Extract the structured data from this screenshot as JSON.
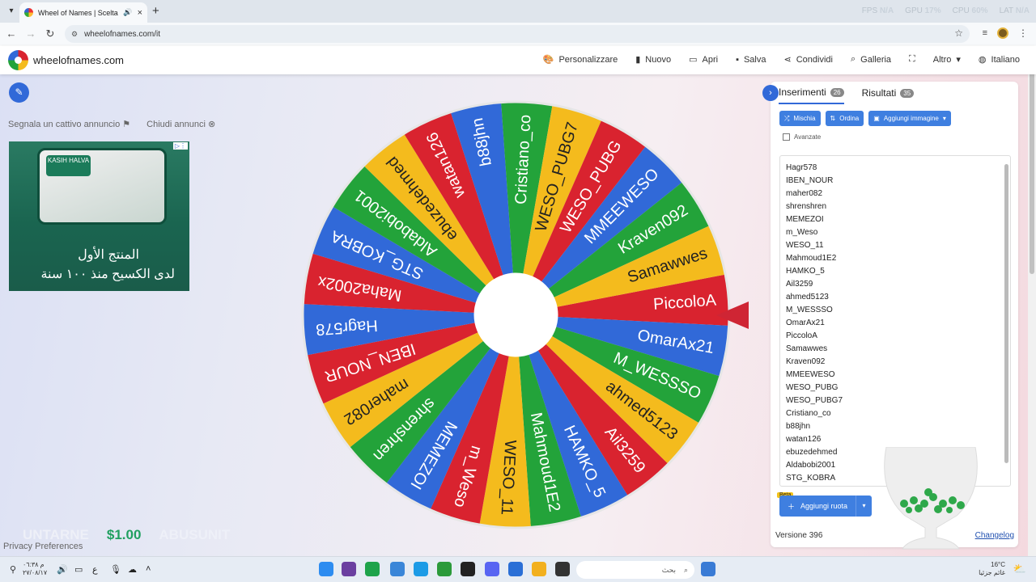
{
  "browser": {
    "tab_title": "Wheel of Names | Scelta ca",
    "url": "wheelofnames.com/it",
    "sys": [
      {
        "label": "FPS",
        "value": "N/A"
      },
      {
        "label": "GPU",
        "value": "17%"
      },
      {
        "label": "CPU",
        "value": "60%"
      },
      {
        "label": "LAT",
        "value": "N/A"
      }
    ]
  },
  "header": {
    "brand": "wheelofnames.com",
    "menu": [
      "Personalizzare",
      "Nuovo",
      "Apri",
      "Salva",
      "Condividi",
      "Galleria",
      "",
      "Altro",
      "Italiano"
    ]
  },
  "left": {
    "report_ad": "Segnala un cattivo annuncio",
    "close_ads": "Chiudi annunci",
    "ad_line1": "المنتج الأول",
    "ad_line2": "لدى الكسيح منذ ١٠٠ سنة",
    "ad_brand": "KASIH HALVA",
    "promo_left": "UNTARNE",
    "promo_price": "$1.00",
    "promo_right": "ABUSUNIT",
    "privacy": "Privacy Preferences"
  },
  "panel": {
    "tab_entries": "Inserimenti",
    "tab_entries_count": "26",
    "tab_results": "Risultati",
    "tab_results_count": "35",
    "btn_shuffle": "Mischia",
    "btn_sort": "Ordina",
    "btn_add_image": "Aggiungi immagine",
    "advanced": "Avanzate",
    "add_wheel": "Aggiungi ruota",
    "beta": "Beta",
    "version": "Versione 396",
    "changelog": "Changelog"
  },
  "entries": [
    "Hagr578",
    "IBEN_NOUR",
    "maher082",
    "shrenshren",
    "MEMEZOI",
    "m_Weso",
    "WESO_11",
    "Mahmoud1E2",
    "HAMKO_5",
    "Ail3259",
    "ahmed5123",
    "M_WESSSO",
    "OmarAx21",
    "PiccoloA",
    "Samawwes",
    "Kraven092",
    "MMEEWESO",
    "WESO_PUBG",
    "WESO_PUBG7",
    "Cristiano_co",
    "b88jhn",
    "watan126",
    "ebuzedehmed",
    "Aldabobi2001",
    "STG_KOBRA"
  ],
  "wheel": {
    "pointer_color": "#cf2534",
    "segments": [
      {
        "label": "PiccoloA",
        "color": "#d9232f"
      },
      {
        "label": "OmarAx21",
        "color": "#3169d8"
      },
      {
        "label": "M_WESSSO",
        "color": "#23a33a"
      },
      {
        "label": "ahmed5123",
        "color": "#f4bb1d"
      },
      {
        "label": "Ail3259",
        "color": "#d9232f"
      },
      {
        "label": "HAMKO_5",
        "color": "#3169d8"
      },
      {
        "label": "Mahmoud1E2",
        "color": "#23a33a"
      },
      {
        "label": "WESO_11",
        "color": "#f4bb1d"
      },
      {
        "label": "m_Weso",
        "color": "#d9232f"
      },
      {
        "label": "MEMEZOI",
        "color": "#3169d8"
      },
      {
        "label": "shrenshren",
        "color": "#23a33a"
      },
      {
        "label": "maher082",
        "color": "#f4bb1d"
      },
      {
        "label": "IBEN_NOUR",
        "color": "#d9232f"
      },
      {
        "label": "Hagr578",
        "color": "#3169d8"
      },
      {
        "label": "Maha2002x",
        "color": "#d9232f"
      },
      {
        "label": "STG_KOBRA",
        "color": "#3169d8"
      },
      {
        "label": "Aldabobi2001",
        "color": "#23a33a"
      },
      {
        "label": "ebuzedehmed",
        "color": "#f4bb1d"
      },
      {
        "label": "watan126",
        "color": "#d9232f"
      },
      {
        "label": "b88jhn",
        "color": "#3169d8"
      },
      {
        "label": "Cristiano_co",
        "color": "#23a33a"
      },
      {
        "label": "WESO_PUBG7",
        "color": "#f4bb1d"
      },
      {
        "label": "WESO_PUBG",
        "color": "#d9232f"
      },
      {
        "label": "MMEEWESO",
        "color": "#3169d8"
      },
      {
        "label": "Kraven092",
        "color": "#23a33a"
      },
      {
        "label": "Samawwes",
        "color": "#f4bb1d"
      }
    ]
  },
  "taskbar": {
    "search_placeholder": "بحث",
    "clock_time": "م ٠٦:٣٨",
    "clock_date": "٢٧/٠٨/١٧",
    "weather_temp": "16°C",
    "weather_desc": "غائم جزئيا"
  }
}
